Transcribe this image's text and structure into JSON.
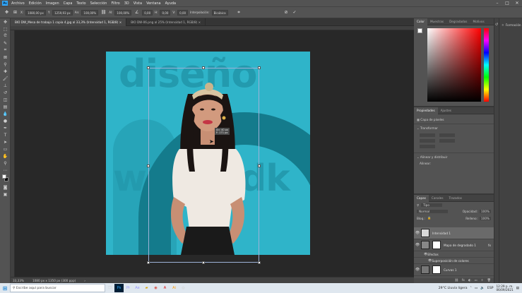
{
  "menubar": {
    "logo": "Ps",
    "items": [
      "Archivo",
      "Edición",
      "Imagen",
      "Capa",
      "Texto",
      "Selección",
      "Filtro",
      "3D",
      "Vista",
      "Ventana",
      "Ayuda"
    ]
  },
  "options_bar": {
    "x_value": "1080,00 px",
    "y_value": "1259,93 px",
    "w_value": "100,00%",
    "h_value": "100,00%",
    "angle_value": "0,00",
    "h_skew": "0,00",
    "v_skew": "0,00",
    "interpolation_label": "Interpolación:",
    "interpolation_value": "Bicúbica"
  },
  "document_tabs": [
    "BIO DW_Mesa de trabajo 1 copia 4.jpg al 33,3% (Intensidad 1, RGB/8)",
    "BIO DW-06.png al 25% (Intensidad 1, RGB/8)"
  ],
  "canvas": {
    "words": [
      "diseño",
      "w",
      "dk"
    ],
    "tooltip": "An: 40 px\nF: 171 px"
  },
  "status": {
    "zoom": "33,33%",
    "doc_size": "1080 px x 1350 px (300 ppp)"
  },
  "color_panel": {
    "tabs": [
      "Color",
      "Muestras",
      "Degradados",
      "Motivos"
    ]
  },
  "properties_panel": {
    "tabs": [
      "Propiedades",
      "Ajustes"
    ],
    "layer_kind": "Capa de píxeles",
    "transform_label": "Transformar",
    "align_label": "Alinear y distribuir",
    "align_sub": "Alinear:"
  },
  "layers_panel": {
    "tabs": [
      "Capas",
      "Canales",
      "Trazados"
    ],
    "filter": "Tipo",
    "blend_mode": "Normal",
    "opacity_label": "Opacidad:",
    "opacity_value": "100%",
    "lock_label": "Bloq.:",
    "fill_label": "Relleno:",
    "fill_value": "100%",
    "layers": [
      {
        "name": "Intensidad 1"
      },
      {
        "name": "Mapa de degradado 1"
      },
      {
        "name": "Efectos"
      },
      {
        "name": "Superposición de colores"
      },
      {
        "name": "Curvas 1"
      }
    ]
  },
  "learn_panel": {
    "label": "Formación"
  },
  "taskbar": {
    "search_placeholder": "Escribe aquí para buscar",
    "weather": "29°C  Lluvia ligera",
    "lang": "ESP",
    "time": "12:29 p. m.",
    "date": "06/09/2021"
  },
  "colors": {
    "artwork_bg": "#2fb4c9",
    "wave": "#147b8c",
    "ui_panel": "#535353"
  }
}
